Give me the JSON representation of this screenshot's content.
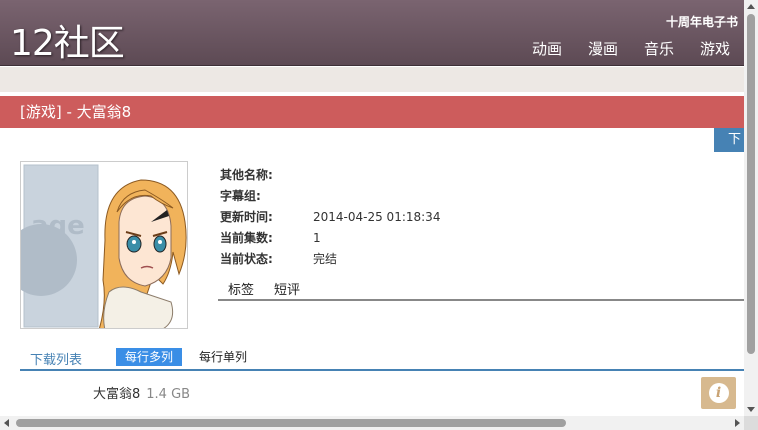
{
  "header": {
    "logo": "12社区",
    "tagline": "十周年电子书",
    "nav": [
      "动画",
      "漫画",
      "音乐",
      "游戏"
    ]
  },
  "title_bar": {
    "title": "[游戏] - 大富翁8"
  },
  "download_tab": {
    "label": "下"
  },
  "cover": {
    "placeholder_text": "age"
  },
  "meta": {
    "rows": [
      {
        "key": "其他名称:",
        "value": ""
      },
      {
        "key": "字幕组:",
        "value": ""
      },
      {
        "key": "更新时间:",
        "value": "2014-04-25 01:18:34"
      },
      {
        "key": "当前集数:",
        "value": "1"
      },
      {
        "key": "当前状态:",
        "value": "完结"
      }
    ]
  },
  "inner_tabs": [
    "标签",
    "短评"
  ],
  "download_list": {
    "label": "下载列表",
    "mode_multi": "每行多列",
    "mode_single": "每行单列",
    "items": [
      {
        "name": "大富翁8",
        "size": "1.4 GB"
      }
    ]
  },
  "info_button": {
    "icon": "i"
  },
  "colors": {
    "header": "#6b5660",
    "title_bar": "#cd5c5c",
    "accent_blue": "#4682b4",
    "active_btn": "#3a8ee6",
    "info_btn": "#d7b98f"
  }
}
